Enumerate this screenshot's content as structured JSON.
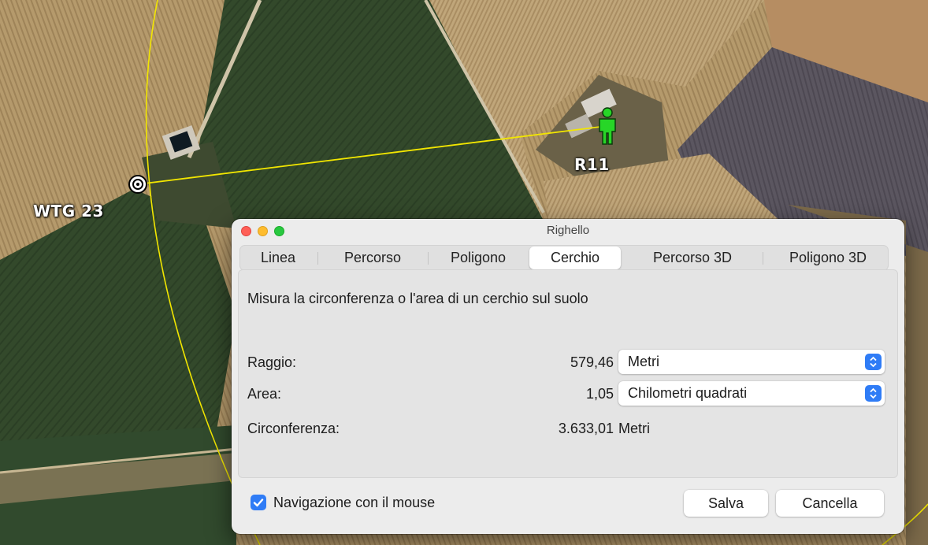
{
  "map": {
    "labels": {
      "turbine": "WTG 23",
      "receptor": "R11"
    },
    "colors": {
      "measure_line": "#f2e600",
      "receptor_icon": "#27d627"
    }
  },
  "dialog": {
    "title": "Righello",
    "window_buttons": [
      "close",
      "minimize",
      "zoom"
    ],
    "tabs": [
      "Linea",
      "Percorso",
      "Poligono",
      "Cerchio",
      "Percorso 3D",
      "Poligono 3D"
    ],
    "active_tab": "Cerchio",
    "description": "Misura la circonferenza o l'area di un cerchio sul suolo",
    "rows": {
      "radius": {
        "label": "Raggio:",
        "value": "579,46",
        "unit": "Metri"
      },
      "area": {
        "label": "Area:",
        "value": "1,05",
        "unit": "Chilometri quadrati"
      },
      "circumference": {
        "label": "Circonferenza:",
        "value": "3.633,01",
        "unit": "Metri"
      }
    },
    "mouse_navigation": {
      "label": "Navigazione con il mouse",
      "checked": true
    },
    "buttons": {
      "save": "Salva",
      "cancel": "Cancella"
    },
    "accent_color": "#2f7cf6"
  }
}
